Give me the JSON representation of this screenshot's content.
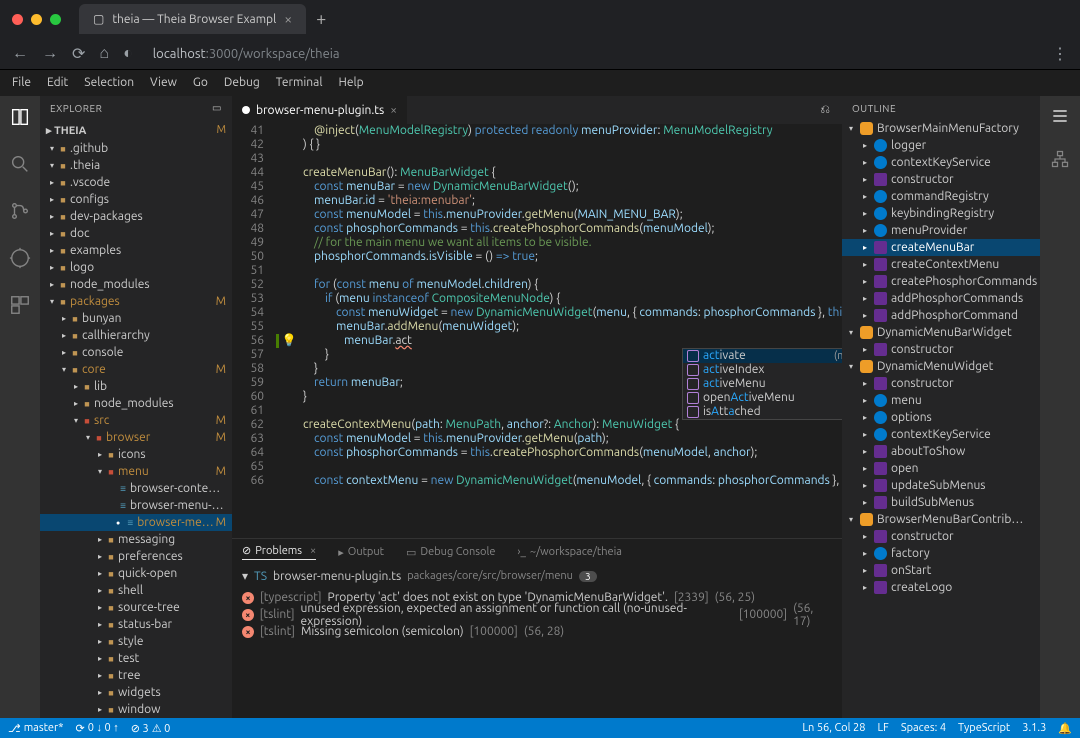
{
  "browser": {
    "tab_title": "theia — Theia Browser Exampl",
    "url_host": "localhost",
    "url_port": ":3000",
    "url_path": "/workspace/theia"
  },
  "menubar": [
    "File",
    "Edit",
    "Selection",
    "View",
    "Go",
    "Debug",
    "Terminal",
    "Help"
  ],
  "sidebar": {
    "title": "EXPLORER",
    "workspace": "THEIA",
    "workspace_status": "M",
    "tree": [
      {
        "depth": 0,
        "expanded": true,
        "type": "folder",
        "label": ".github"
      },
      {
        "depth": 0,
        "expanded": true,
        "type": "folder",
        "label": ".theia"
      },
      {
        "depth": 0,
        "expanded": false,
        "type": "folder",
        "label": ".vscode"
      },
      {
        "depth": 0,
        "expanded": false,
        "type": "folder",
        "label": "configs"
      },
      {
        "depth": 0,
        "expanded": false,
        "type": "folder",
        "label": "dev-packages"
      },
      {
        "depth": 0,
        "expanded": false,
        "type": "folder",
        "label": "doc"
      },
      {
        "depth": 0,
        "expanded": false,
        "type": "folder",
        "label": "examples"
      },
      {
        "depth": 0,
        "expanded": false,
        "type": "folder",
        "label": "logo"
      },
      {
        "depth": 0,
        "expanded": false,
        "type": "folder",
        "label": "node_modules"
      },
      {
        "depth": 0,
        "expanded": true,
        "type": "folder",
        "label": "packages",
        "status": "M"
      },
      {
        "depth": 1,
        "expanded": false,
        "type": "folder",
        "label": "bunyan"
      },
      {
        "depth": 1,
        "expanded": false,
        "type": "folder",
        "label": "callhierarchy"
      },
      {
        "depth": 1,
        "expanded": false,
        "type": "folder",
        "label": "console"
      },
      {
        "depth": 1,
        "expanded": true,
        "type": "folder",
        "label": "core",
        "status": "M"
      },
      {
        "depth": 2,
        "expanded": false,
        "type": "folder",
        "label": "lib"
      },
      {
        "depth": 2,
        "expanded": false,
        "type": "folder",
        "label": "node_modules"
      },
      {
        "depth": 2,
        "expanded": true,
        "type": "folder-red",
        "label": "src",
        "status": "M"
      },
      {
        "depth": 3,
        "expanded": true,
        "type": "folder-red",
        "label": "browser",
        "status": "M"
      },
      {
        "depth": 4,
        "expanded": false,
        "type": "folder",
        "label": "icons"
      },
      {
        "depth": 4,
        "expanded": true,
        "type": "folder-red",
        "label": "menu",
        "status": "M"
      },
      {
        "depth": 5,
        "type": "file",
        "label": "browser-context-menu-r…"
      },
      {
        "depth": 5,
        "type": "file",
        "label": "browser-menu-module.ts"
      },
      {
        "depth": 5,
        "type": "file",
        "label": "browser-menu-plugin.ts",
        "status": "M",
        "selected": true,
        "dirty": true
      },
      {
        "depth": 4,
        "expanded": false,
        "type": "folder",
        "label": "messaging"
      },
      {
        "depth": 4,
        "expanded": false,
        "type": "folder",
        "label": "preferences"
      },
      {
        "depth": 4,
        "expanded": false,
        "type": "folder",
        "label": "quick-open"
      },
      {
        "depth": 4,
        "expanded": false,
        "type": "folder",
        "label": "shell"
      },
      {
        "depth": 4,
        "expanded": false,
        "type": "folder",
        "label": "source-tree"
      },
      {
        "depth": 4,
        "expanded": false,
        "type": "folder",
        "label": "status-bar"
      },
      {
        "depth": 4,
        "expanded": false,
        "type": "folder",
        "label": "style"
      },
      {
        "depth": 4,
        "expanded": false,
        "type": "folder",
        "label": "test"
      },
      {
        "depth": 4,
        "expanded": false,
        "type": "folder",
        "label": "tree"
      },
      {
        "depth": 4,
        "expanded": false,
        "type": "folder",
        "label": "widgets"
      },
      {
        "depth": 4,
        "expanded": false,
        "type": "folder",
        "label": "window"
      }
    ]
  },
  "editor": {
    "tab_name": "browser-menu-plugin.ts",
    "first_line": 41,
    "autocomplete": {
      "signature": "(method) Widget.activate(): void",
      "items": [
        {
          "left": "act",
          "right": "ivate",
          "sel": true
        },
        {
          "left": "act",
          "right": "iveIndex"
        },
        {
          "left": "act",
          "right": "iveMenu"
        },
        {
          "left": "openAct",
          "right": "iveMenu",
          "pre": "open"
        },
        {
          "left": "isAtt",
          "right": "ached",
          "pre": "is",
          "mid": "A",
          "mid2": "tt",
          "mid3": "a"
        }
      ]
    }
  },
  "panel": {
    "tabs": {
      "problems": "Problems",
      "output": "Output",
      "debug": "Debug Console",
      "terminal": "~/workspace/theia"
    },
    "file": "browser-menu-plugin.ts",
    "file_path": "packages/core/src/browser/menu",
    "count": "3",
    "problems": [
      {
        "sev": "error",
        "src": "[typescript]",
        "msg": "Property 'act' does not exist on type 'DynamicMenuBarWidget'.",
        "code": "[2339]",
        "loc": "(56, 25)"
      },
      {
        "sev": "error",
        "src": "[tslint]",
        "msg": "unused expression, expected an assignment or function call (no-unused-expression)",
        "code": "[100000]",
        "loc": "(56, 17)"
      },
      {
        "sev": "error",
        "src": "[tslint]",
        "msg": "Missing semicolon (semicolon)",
        "code": "[100000]",
        "loc": "(56, 28)"
      }
    ]
  },
  "outline": {
    "title": "OUTLINE",
    "items": [
      {
        "depth": 0,
        "kind": "class",
        "label": "BrowserMainMenuFactory",
        "expanded": true
      },
      {
        "depth": 1,
        "kind": "field",
        "label": "logger"
      },
      {
        "depth": 1,
        "kind": "field",
        "label": "contextKeyService"
      },
      {
        "depth": 1,
        "kind": "method",
        "label": "constructor"
      },
      {
        "depth": 1,
        "kind": "field",
        "label": "commandRegistry"
      },
      {
        "depth": 1,
        "kind": "field",
        "label": "keybindingRegistry"
      },
      {
        "depth": 1,
        "kind": "field",
        "label": "menuProvider"
      },
      {
        "depth": 1,
        "kind": "method",
        "label": "createMenuBar",
        "selected": true
      },
      {
        "depth": 1,
        "kind": "method",
        "label": "createContextMenu"
      },
      {
        "depth": 1,
        "kind": "method",
        "label": "createPhosphorCommands"
      },
      {
        "depth": 1,
        "kind": "method",
        "label": "addPhosphorCommands"
      },
      {
        "depth": 1,
        "kind": "method",
        "label": "addPhosphorCommand"
      },
      {
        "depth": 0,
        "kind": "class",
        "label": "DynamicMenuBarWidget",
        "expanded": true
      },
      {
        "depth": 1,
        "kind": "method",
        "label": "constructor"
      },
      {
        "depth": 0,
        "kind": "class",
        "label": "DynamicMenuWidget",
        "expanded": true
      },
      {
        "depth": 1,
        "kind": "method",
        "label": "constructor"
      },
      {
        "depth": 1,
        "kind": "field",
        "label": "menu"
      },
      {
        "depth": 1,
        "kind": "field",
        "label": "options"
      },
      {
        "depth": 1,
        "kind": "field",
        "label": "contextKeyService"
      },
      {
        "depth": 1,
        "kind": "method",
        "label": "aboutToShow"
      },
      {
        "depth": 1,
        "kind": "method",
        "label": "open"
      },
      {
        "depth": 1,
        "kind": "method",
        "label": "updateSubMenus"
      },
      {
        "depth": 1,
        "kind": "method",
        "label": "buildSubMenus"
      },
      {
        "depth": 0,
        "kind": "class",
        "label": "BrowserMenuBarContrib…",
        "expanded": true
      },
      {
        "depth": 1,
        "kind": "method",
        "label": "constructor"
      },
      {
        "depth": 1,
        "kind": "field",
        "label": "factory"
      },
      {
        "depth": 1,
        "kind": "method",
        "label": "onStart"
      },
      {
        "depth": 1,
        "kind": "method",
        "label": "createLogo"
      }
    ]
  },
  "statusbar": {
    "branch": "master*",
    "sync": "0 ↓ 0 ↑",
    "errors": "3",
    "warnings": "0",
    "cursor": "Ln 56, Col 28",
    "eol": "LF",
    "indent": "Spaces: 4",
    "lang": "TypeScript",
    "version": "3.1.3"
  }
}
